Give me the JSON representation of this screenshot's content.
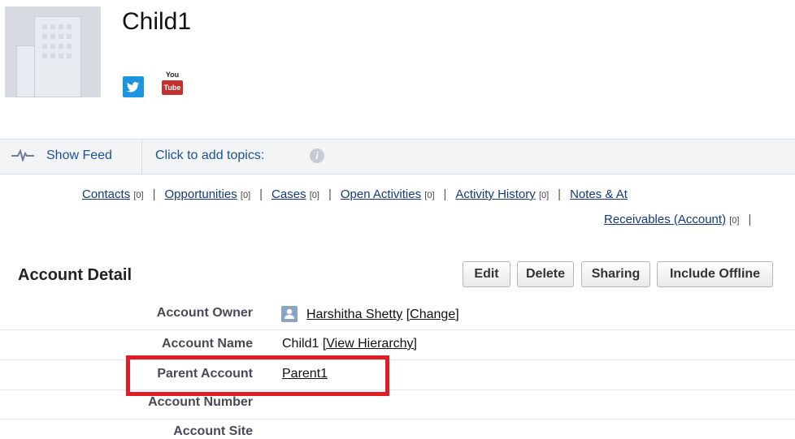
{
  "header": {
    "title": "Child1",
    "social": {
      "twitter": "twitter-icon",
      "youtube_top": "You",
      "youtube_bottom": "Tube"
    }
  },
  "feedbar": {
    "show_feed": "Show Feed",
    "topics": "Click to add topics:",
    "info": "i"
  },
  "related": {
    "sep": "|",
    "row1": [
      {
        "label": "Contacts",
        "count": "[0]"
      },
      {
        "label": "Opportunities",
        "count": "[0]"
      },
      {
        "label": "Cases",
        "count": "[0]"
      },
      {
        "label": "Open Activities",
        "count": "[0]"
      },
      {
        "label": "Activity History",
        "count": "[0]"
      },
      {
        "label": "Notes & At",
        "count": ""
      }
    ],
    "row2": [
      {
        "label": "Receivables (Account)",
        "count": "[0]"
      }
    ]
  },
  "detail": {
    "title": "Account Detail",
    "buttons": {
      "edit": "Edit",
      "delete": "Delete",
      "sharing": "Sharing",
      "offline": "Include Offline"
    },
    "fields": [
      {
        "label": "Account Owner",
        "value": "Harshitha Shetty",
        "link2": "[Change]"
      },
      {
        "label": "Account Name",
        "value": "Child1",
        "link2": "[View Hierarchy]"
      },
      {
        "label": "Parent Account",
        "value": "Parent1"
      },
      {
        "label": "Account Number",
        "value": ""
      },
      {
        "label": "Account Site",
        "value": ""
      }
    ]
  },
  "colors": {
    "highlight": "#e01c25",
    "link": "#15387d"
  }
}
